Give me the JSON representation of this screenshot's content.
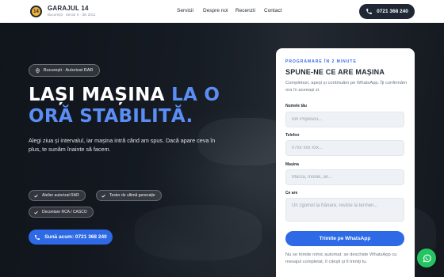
{
  "brand": {
    "badge": "14",
    "name": "GARAJUL 14",
    "subtitle": "București · Sector 6 · din 2011"
  },
  "nav": {
    "items": [
      {
        "label": "Servicii"
      },
      {
        "label": "Despre noi"
      },
      {
        "label": "Recenzii"
      },
      {
        "label": "Contact"
      }
    ],
    "phone_label": "0721 368 240"
  },
  "hero": {
    "location": "București · Autorizat RAR",
    "heading_line1_white": "LAȘI MAȘINA ",
    "heading_line1_blue": "LA O",
    "heading_line2_blue": "ORĂ STABILITĂ.",
    "lead": "Alegi ziua și intervalul, iar mașina intră când am spus. Dacă apare ceva în plus, te sunăm înainte să facem.",
    "chips": [
      "Atelier autorizat RAR",
      "Tester de ultimă generație",
      "Decontare RCA / CASCO"
    ],
    "cta_label": "Sună acum: 0721 368 240"
  },
  "form": {
    "eyebrow": "PROGRAMARE ÎN 2 MINUTE",
    "title": "SPUNE-NE CE ARE MAȘINA",
    "description": "Completezi, apeși și continuăm pe WhatsApp. Îți confirmăm ora în aceeași zi.",
    "fields": {
      "name": {
        "label": "Numele tău",
        "placeholder": "Ion Popescu...",
        "value": ""
      },
      "phone": {
        "label": "Telefon",
        "placeholder": "07xx xxx xxx...",
        "value": ""
      },
      "car": {
        "label": "Mașina",
        "placeholder": "Marcă, model, an...",
        "value": ""
      },
      "issue": {
        "label": "Ce are",
        "placeholder": "Un zgomot la frânare, revizie la termen...",
        "value": ""
      }
    },
    "submit_label": "Trimite pe WhatsApp",
    "note": "Nu se trimite nimic automat: se deschide WhatsApp cu mesajul completat, îl citești și îl trimiți tu."
  },
  "colors": {
    "accent": "#2e6ae6",
    "accent_text": "#5b8ef5",
    "dark": "#1e2733",
    "whatsapp": "#25c463",
    "badge": "#f2b233"
  },
  "icons": {
    "phone": "phone-icon",
    "location": "map-pin-icon",
    "check": "check-icon",
    "whatsapp": "whatsapp-icon"
  }
}
